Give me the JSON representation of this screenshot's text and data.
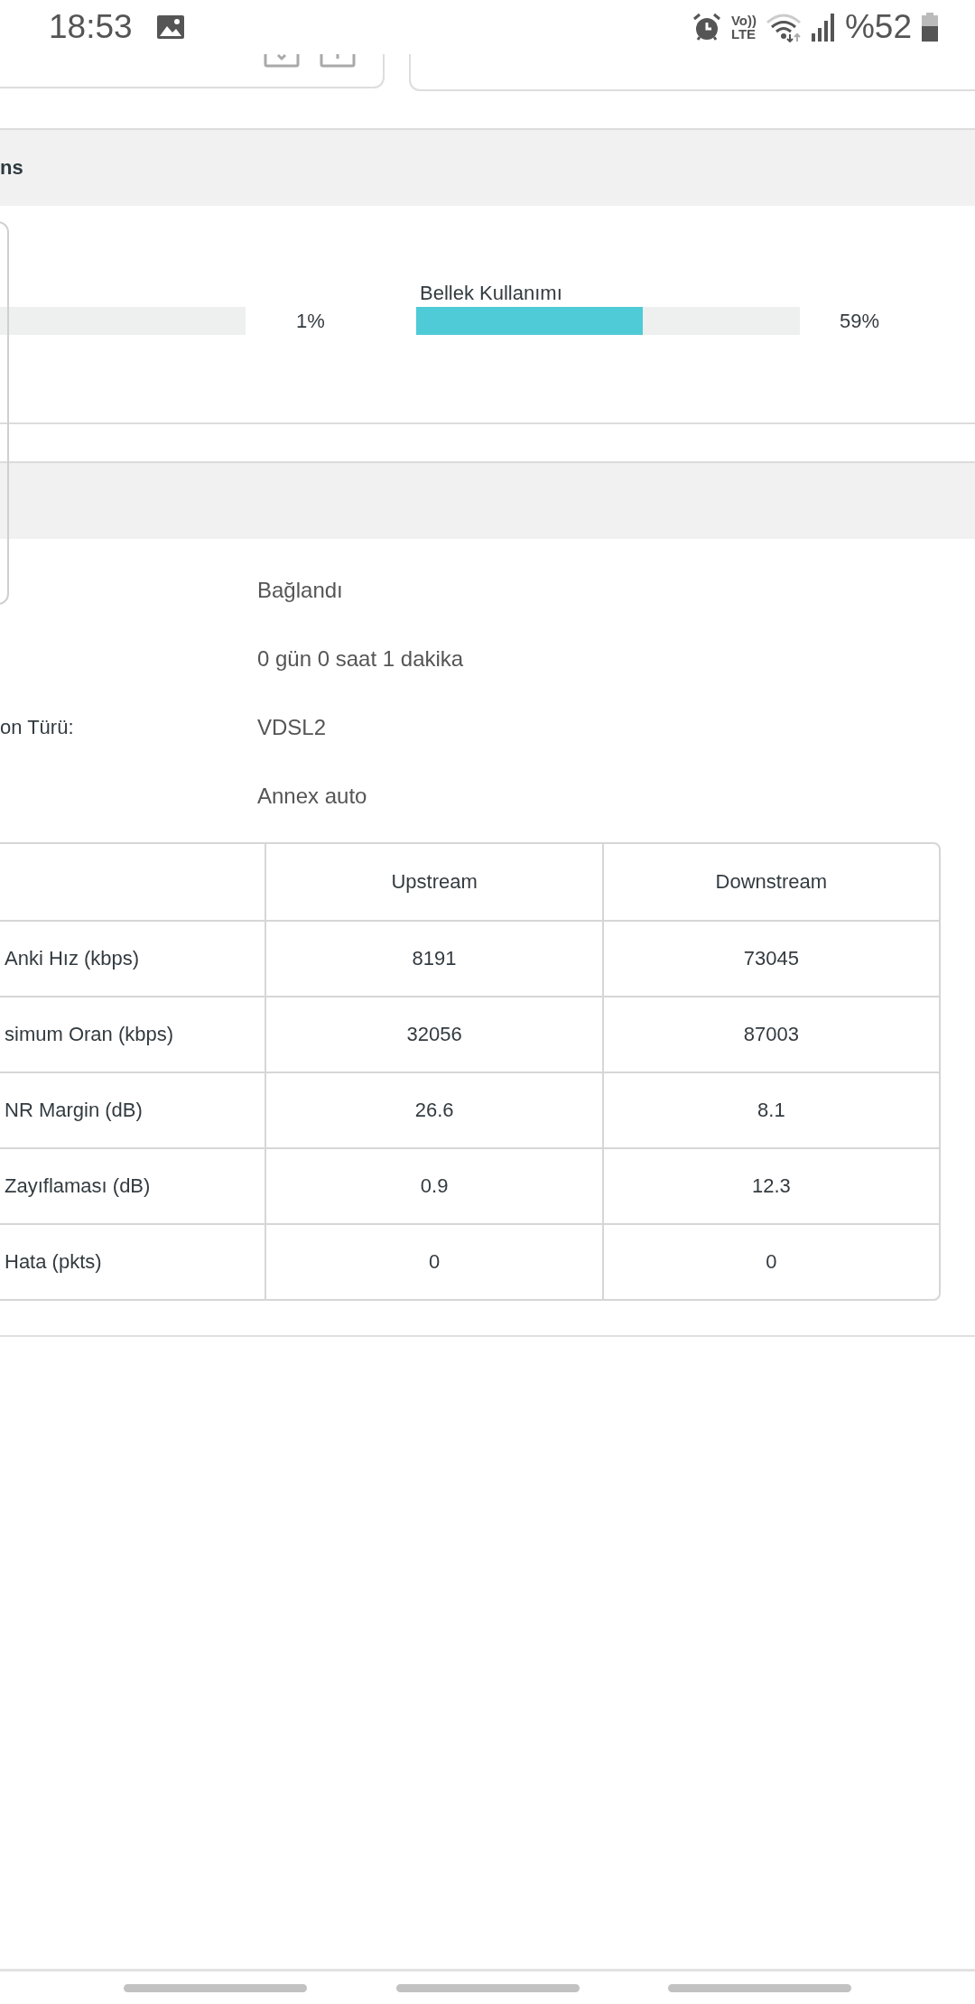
{
  "status_bar": {
    "time": "18:53",
    "volte_top": "Vo))",
    "volte_bottom": "LTE",
    "battery": "%52"
  },
  "sections": [
    {
      "title": "ns"
    }
  ],
  "meters": [
    {
      "reading": "1%"
    },
    {
      "label": "Bellek Kullanımı",
      "level": 0.59,
      "reading": "59%"
    }
  ],
  "info_rows": [
    {
      "value": "Bağlandı"
    },
    {
      "value": "0 gün 0 saat 1 dakika"
    },
    {
      "label": "on Türü:",
      "value": "VDSL2"
    },
    {
      "value": "Annex auto"
    }
  ],
  "table": {
    "columns": [
      "Upstream",
      "Downstream"
    ],
    "rows": [
      {
        "label": "Anki Hız (kbps)",
        "cells": [
          "8191",
          "73045"
        ]
      },
      {
        "label": "simum Oran (kbps)",
        "cells": [
          "32056",
          "87003"
        ]
      },
      {
        "label": "NR Margin (dB)",
        "cells": [
          "26.6",
          "8.1"
        ]
      },
      {
        "label": "Zayıflaması (dB)",
        "cells": [
          "0.9",
          "12.3"
        ]
      },
      {
        "label": "Hata (pkts)",
        "cells": [
          "0",
          "0"
        ]
      }
    ]
  }
}
